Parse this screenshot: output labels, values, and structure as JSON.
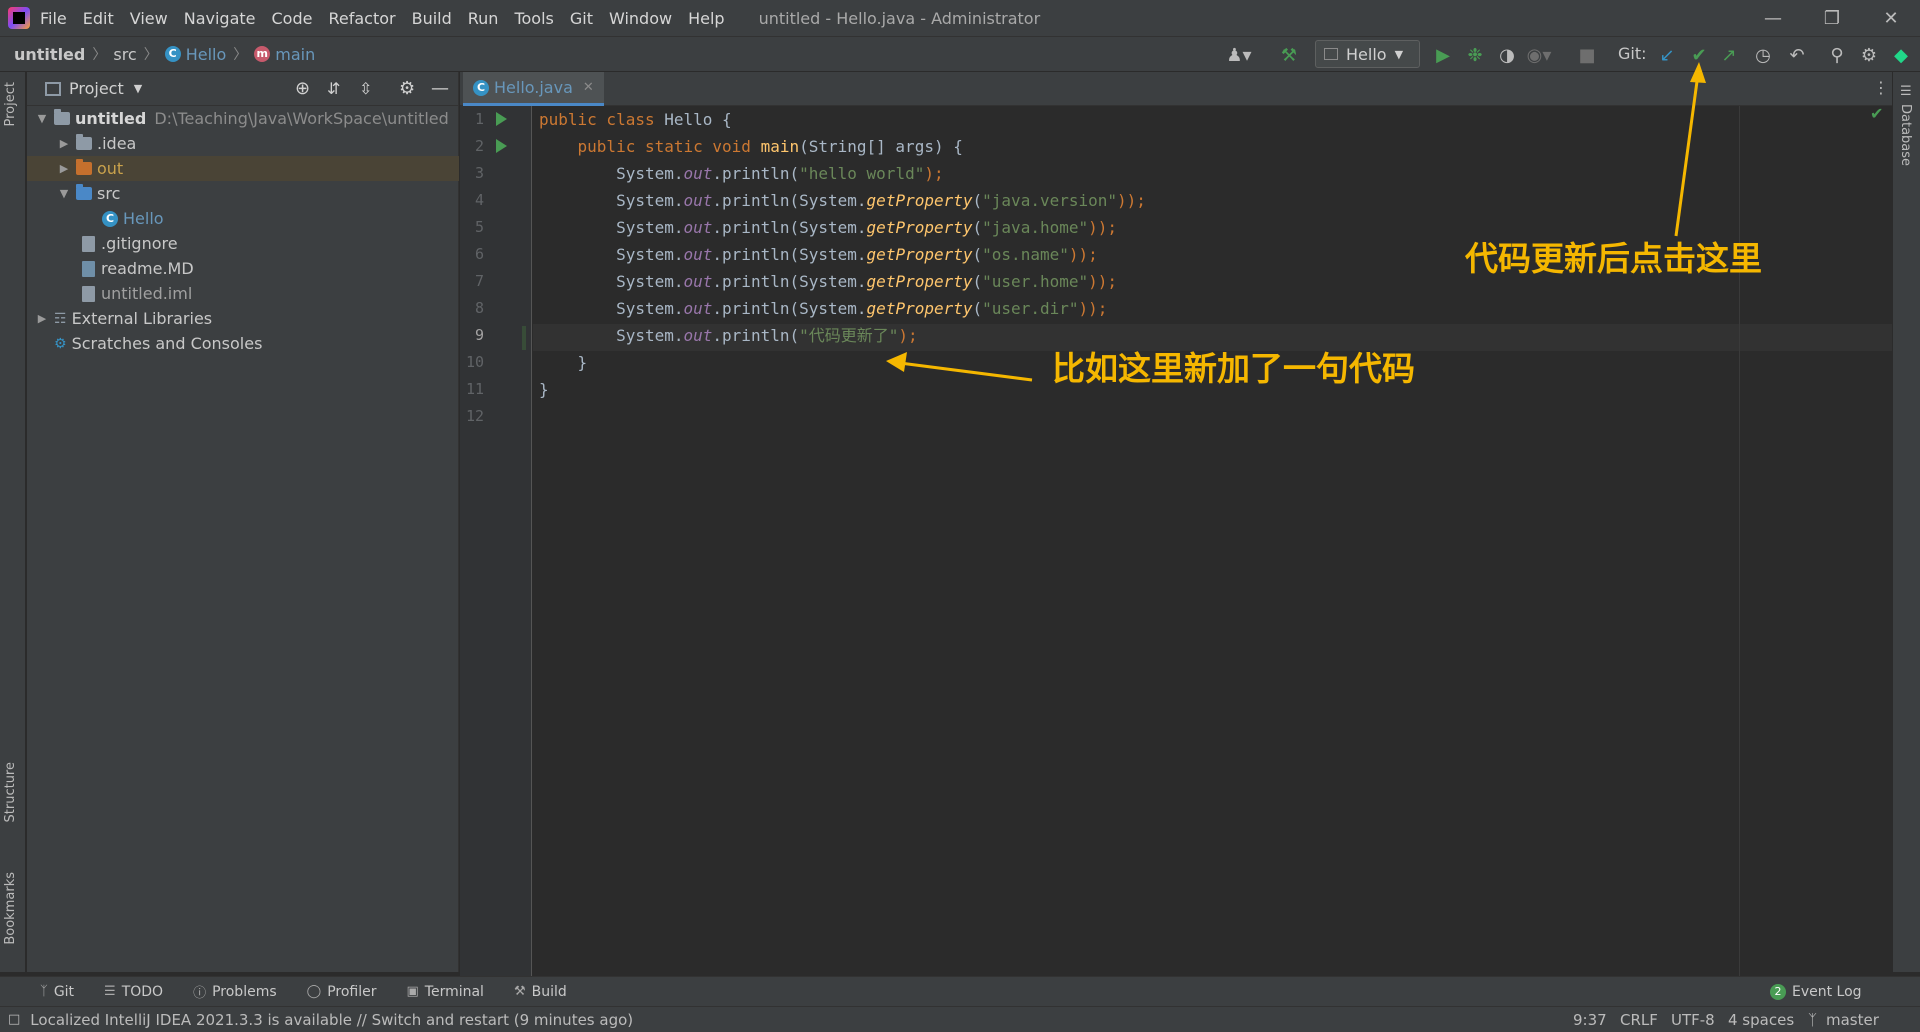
{
  "menubar": {
    "items": [
      "File",
      "Edit",
      "View",
      "Navigate",
      "Code",
      "Refactor",
      "Build",
      "Run",
      "Tools",
      "Git",
      "Window",
      "Help"
    ],
    "window_title": "untitled - Hello.java - Administrator"
  },
  "breadcrumb": {
    "project": "untitled",
    "folder": "src",
    "class": "Hello",
    "method": "main"
  },
  "toolbar": {
    "run_config": "Hello",
    "git_label": "Git:"
  },
  "project_panel": {
    "title": "Project",
    "tree": [
      {
        "label": "untitled",
        "path": "D:\\Teaching\\Java\\WorkSpace\\untitled"
      },
      {
        "label": ".idea"
      },
      {
        "label": "out"
      },
      {
        "label": "src"
      },
      {
        "label": "Hello"
      },
      {
        "label": ".gitignore"
      },
      {
        "label": "readme.MD"
      },
      {
        "label": "untitled.iml"
      },
      {
        "label": "External Libraries"
      },
      {
        "label": "Scratches and Consoles"
      }
    ]
  },
  "left_strip": {
    "project_tab": "Project",
    "structure_tab": "Structure",
    "bookmarks_tab": "Bookmarks"
  },
  "right_strip": {
    "database_tab": "Database"
  },
  "editor": {
    "tab_label": "Hello.java",
    "line_numbers": [
      "1",
      "2",
      "3",
      "4",
      "5",
      "6",
      "7",
      "8",
      "9",
      "10",
      "11",
      "12"
    ],
    "code": {
      "l1_kw": "public class ",
      "l1_rest": "Hello {",
      "l2_indent": "    ",
      "l2_kw": "public static void ",
      "l2_fn": "main",
      "l2_rest": "(String[] args) {",
      "sys": "        System.",
      "out": "out",
      "println": ".println(",
      "sysprop": "System.",
      "getprop": "getProperty",
      "s3": "\"hello world\"",
      "s4": "\"java.version\"",
      "s5": "\"java.home\"",
      "s6": "\"os.name\"",
      "s7": "\"user.home\"",
      "s8": "\"user.dir\"",
      "s9": "\"代码更新了\"",
      "open_paren": "(",
      "close1": ");",
      "close2": "));",
      "l10": "    }",
      "l11": "}"
    }
  },
  "bottom_tools": {
    "git": "Git",
    "todo": "TODO",
    "problems": "Problems",
    "profiler": "Profiler",
    "terminal": "Terminal",
    "build": "Build",
    "event_log": "Event Log",
    "event_count": "2"
  },
  "status_bar": {
    "message": "Localized IntelliJ IDEA 2021.3.3 is available // Switch and restart (9 minutes ago)",
    "position": "9:37",
    "line_sep": "CRLF",
    "encoding": "UTF-8",
    "indent": "4 spaces",
    "branch": "master"
  },
  "annotations": {
    "top_note": "代码更新后点击这里",
    "code_note": "比如这里新加了一句代码"
  },
  "colors": {
    "annotation": "#f5b700",
    "keyword": "#cc7832",
    "string": "#6a8759",
    "field": "#9876aa",
    "function": "#ffc66d"
  }
}
